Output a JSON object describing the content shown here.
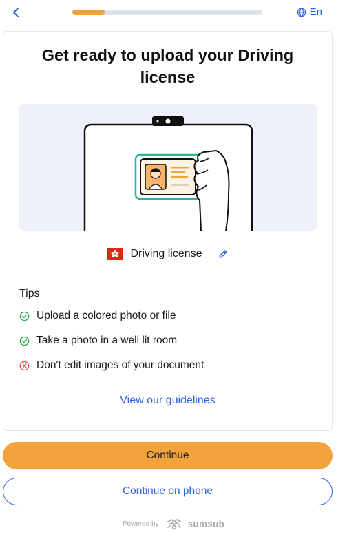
{
  "header": {
    "progress_fraction": 0.17,
    "language": "En"
  },
  "card": {
    "title": "Get ready to upload your Driving license",
    "document": {
      "label": "Driving license",
      "flag_icon": "hong-kong-flag-icon"
    },
    "tips": {
      "title": "Tips",
      "items": [
        {
          "text": "Upload a colored photo or file",
          "icon": "check-circle-icon",
          "color": "#28a745"
        },
        {
          "text": "Take a photo in a well lit room",
          "icon": "check-circle-icon",
          "color": "#28a745"
        },
        {
          "text": "Don't edit images of your document",
          "icon": "x-circle-icon",
          "color": "#e5484d"
        }
      ]
    },
    "guidelines_link": "View our guidelines"
  },
  "actions": {
    "continue_label": "Continue",
    "continue_phone_label": "Continue on phone"
  },
  "footer": {
    "powered_by": "Powered by",
    "brand": "sumsub"
  },
  "colors": {
    "accent": "#f2a33c",
    "link": "#2e62d9"
  }
}
